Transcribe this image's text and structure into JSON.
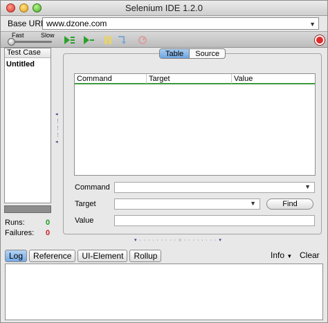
{
  "window": {
    "title": "Selenium IDE 1.2.0"
  },
  "base_url": {
    "label": "Base URL",
    "value": "www.dzone.com"
  },
  "speed": {
    "fast_label": "Fast",
    "slow_label": "Slow"
  },
  "toolbar": {
    "icons": [
      "play-all-icon",
      "play-current-icon",
      "pause-icon",
      "step-icon",
      "rollup-icon",
      "record-icon"
    ]
  },
  "test_case_panel": {
    "header": "Test Case",
    "items": [
      "Untitled"
    ]
  },
  "stats": {
    "runs_label": "Runs:",
    "runs_value": "0",
    "failures_label": "Failures:",
    "failures_value": "0"
  },
  "editor_tabs": {
    "table": "Table",
    "source": "Source"
  },
  "grid": {
    "columns": [
      "Command",
      "Target",
      "Value"
    ]
  },
  "fields": {
    "command_label": "Command",
    "target_label": "Target",
    "value_label": "Value",
    "find_button": "Find"
  },
  "bottom": {
    "tabs": [
      "Log",
      "Reference",
      "UI-Element",
      "Rollup"
    ],
    "info": "Info",
    "clear": "Clear"
  },
  "colors": {
    "accent_tab": "#6fa5e1",
    "grid_header_line": "#3c9a3c",
    "runs": "#1f9a1f",
    "failures": "#c62020",
    "record": "#e12b2b"
  }
}
